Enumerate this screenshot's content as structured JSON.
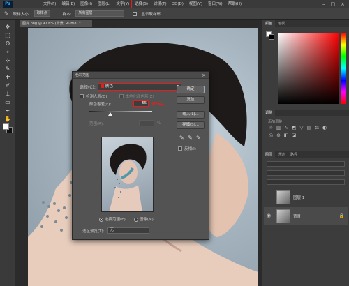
{
  "app": {
    "logo": "Ps"
  },
  "menu": {
    "items": [
      "文件(F)",
      "编辑(E)",
      "图像(I)",
      "图层(L)",
      "文字(Y)",
      "选择(S)",
      "滤镜(T)",
      "3D(D)",
      "视图(V)",
      "窗口(W)",
      "帮助(H)"
    ],
    "highlighted_index": 5
  },
  "options_bar": {
    "sample_size_label": "取样大小:",
    "sample_size_value": "取样点",
    "sample_label": "样本:",
    "sample_value": "所有图层",
    "show_ring_label": "显示取样环"
  },
  "document": {
    "tab_title": "图片.png @ 97.6% (背景, RGB/8) *"
  },
  "dialog": {
    "title": "色彩范围",
    "select_label": "选择(C):",
    "select_value": "肤色",
    "detect_faces_label": "检测人脸(D)",
    "localized_label": "本地化颜色簇(Z)",
    "fuzziness_label": "颜色容差(F):",
    "fuzziness_value": "55",
    "range_label": "范围(R):",
    "range_unit": "%",
    "selection_label": "选择范围(E)",
    "image_label": "图像(M)",
    "preview_label": "选区预览(T):",
    "preview_value": "无",
    "buttons": {
      "ok": "确定",
      "cancel": "复位",
      "load": "载入(L)...",
      "save": "存储(S)..."
    },
    "invert_label": "反相(I)"
  },
  "panels": {
    "color_tabs": [
      "颜色",
      "色板"
    ],
    "adjust_tab": "调整",
    "adjust_hint": "添加调整",
    "layers_tabs": [
      "图层",
      "通道",
      "路径"
    ],
    "layers": [
      {
        "name": "图层 1"
      },
      {
        "name": "背景"
      }
    ]
  },
  "colors": {
    "accent_red": "#e0201e"
  }
}
